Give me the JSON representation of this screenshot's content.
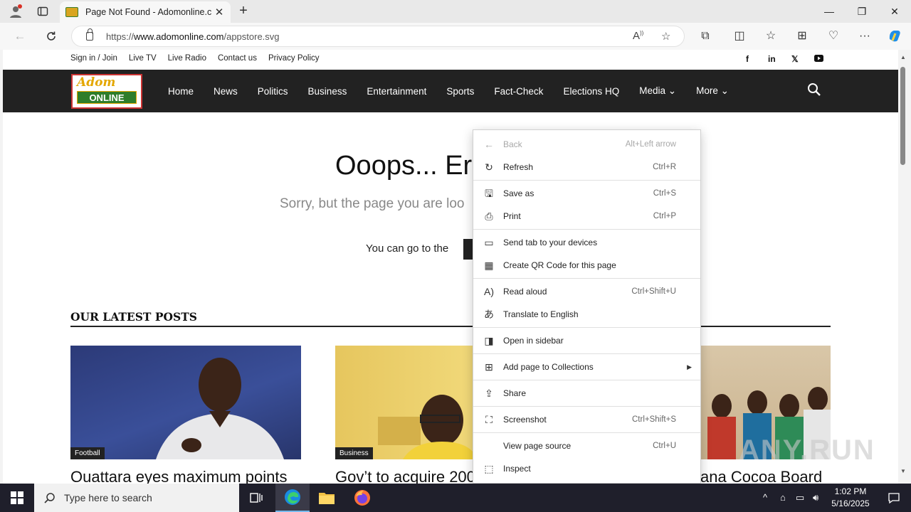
{
  "browser": {
    "tab_title": "Page Not Found - Adomonline.c",
    "url_prefix": "https://",
    "url_domain": "www.adomonline.com",
    "url_path": "/appstore.svg"
  },
  "site": {
    "top_links": [
      "Sign in / Join",
      "Live TV",
      "Live Radio",
      "Contact us",
      "Privacy Policy"
    ],
    "logo_top": "Adom",
    "logo_bottom": "ONLINE",
    "nav": [
      "Home",
      "News",
      "Politics",
      "Business",
      "Entertainment",
      "Sports",
      "Fact-Check",
      "Elections HQ",
      "Media",
      "More"
    ],
    "error_title": "Ooops... Er",
    "error_subtitle": "Sorry, but the page you are loo",
    "error_go": "You can go to the",
    "latest_heading": "OUR LATEST POSTS",
    "posts": [
      {
        "category": "Football",
        "title": "Ouattara eyes maximum points"
      },
      {
        "category": "Business",
        "title": "Gov’t to acquire 200"
      },
      {
        "category": "",
        "title": "ana Cocoa Board"
      }
    ],
    "watermark": "ANY.RUN"
  },
  "context_menu": {
    "items": [
      {
        "label": "Back",
        "shortcut": "Alt+Left arrow",
        "icon": "back-arrow-icon",
        "disabled": true
      },
      {
        "label": "Refresh",
        "shortcut": "Ctrl+R",
        "icon": "refresh-icon"
      },
      {
        "label": "Save as",
        "shortcut": "Ctrl+S",
        "icon": "save-icon"
      },
      {
        "label": "Print",
        "shortcut": "Ctrl+P",
        "icon": "print-icon"
      },
      {
        "label": "Send tab to your devices",
        "shortcut": "",
        "icon": "devices-icon"
      },
      {
        "label": "Create QR Code for this page",
        "shortcut": "",
        "icon": "qr-code-icon"
      },
      {
        "label": "Read aloud",
        "shortcut": "Ctrl+Shift+U",
        "icon": "read-aloud-icon"
      },
      {
        "label": "Translate to English",
        "shortcut": "",
        "icon": "translate-icon"
      },
      {
        "label": "Open in sidebar",
        "shortcut": "",
        "icon": "sidebar-icon"
      },
      {
        "label": "Add page to Collections",
        "shortcut": "",
        "icon": "collections-icon"
      },
      {
        "label": "Share",
        "shortcut": "",
        "icon": "share-icon"
      },
      {
        "label": "Screenshot",
        "shortcut": "Ctrl+Shift+S",
        "icon": "screenshot-icon"
      },
      {
        "label": "View page source",
        "shortcut": "Ctrl+U",
        "icon": ""
      },
      {
        "label": "Inspect",
        "shortcut": "",
        "icon": "inspect-icon"
      }
    ]
  },
  "taskbar": {
    "search_placeholder": "Type here to search",
    "time": "1:02 PM",
    "date": "5/16/2025"
  },
  "colors": {
    "nav_bg": "#222222",
    "logo_green": "#2e7d2a",
    "logo_gold": "#e4a700",
    "taskbar_bg": "#1f1f2b"
  }
}
